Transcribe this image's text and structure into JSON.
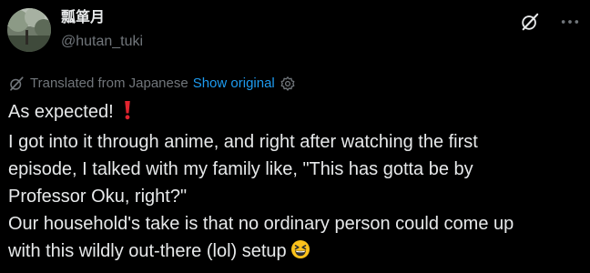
{
  "author": {
    "display_name": "瓢箪月",
    "handle": "@hutan_tuki"
  },
  "icons": {
    "top_actions": [
      "grok-icon",
      "more-icon"
    ],
    "translation": "translate-icon",
    "settings": "settings-icon",
    "emoji_exclamation": "red-exclamation-icon",
    "emoji_laugh": "grinning-squinting-face-icon"
  },
  "translation": {
    "label": "Translated from Japanese",
    "show_original": "Show original"
  },
  "tweet": {
    "lines": [
      "As expected!",
      "I got into it through anime, and right after watching the first",
      "episode, I talked with my family like, \"This has gotta be by",
      "Professor Oku, right?\"",
      "Our household's take is that no ordinary person could come up",
      "with this wildly out-there (lol) setup"
    ]
  },
  "colors": {
    "background": "#000000",
    "text": "#e7e9ea",
    "secondary": "#71767b",
    "link": "#1d9bf0"
  }
}
